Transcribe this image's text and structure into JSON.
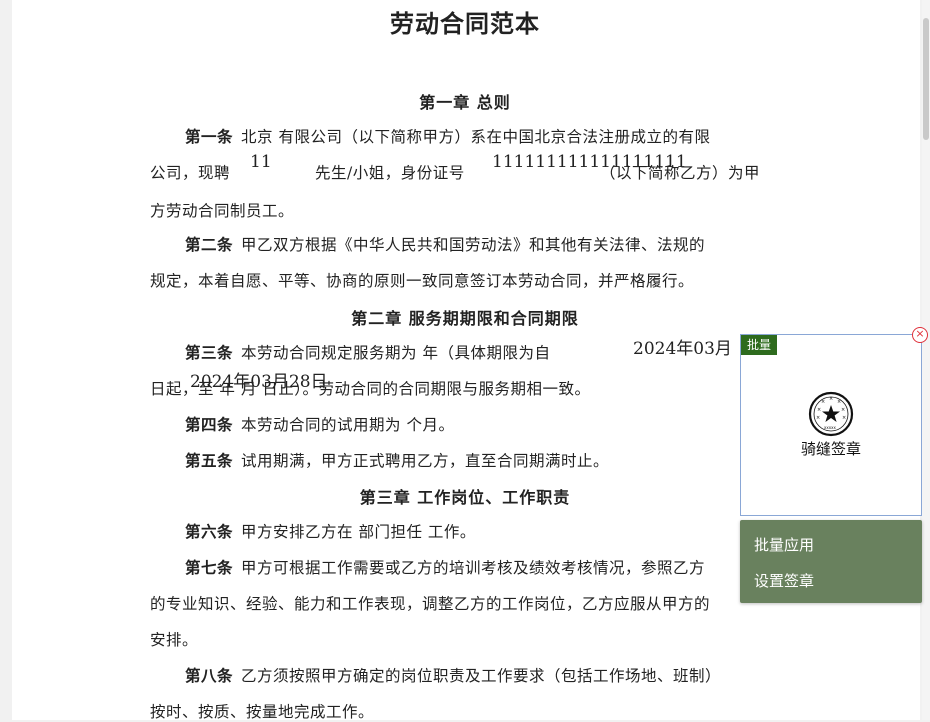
{
  "document": {
    "title": "劳动合同范本",
    "chapter1": "第一章  总则",
    "art1_label": "第一条",
    "art1_l1": "北京  有限公司（以下简称甲方）系在中国北京合法注册成立的有限",
    "art1_l2a": "公司，现聘",
    "art1_l2b": "先生/小姐，身份证号",
    "art1_l2c": "（以下简称乙方）为甲",
    "art1_l3": "方劳动合同制员工。",
    "art2_label": "第二条",
    "art2_l1": "甲乙双方根据《中华人民共和国劳动法》和其他有关法律、法规的",
    "art2_l2": "规定，本着自愿、平等、协商的原则一致同意签订本劳动合同，并严格履行。",
    "chapter2": "第二章  服务期期限和合同期限",
    "art3_label": "第三条",
    "art3_l1": "本劳动合同规定服务期为      年（具体期限为自",
    "art3_l2": "日起，至      年    月      日止）。劳动合同的合同期限与服务期相一致。",
    "art4_label": "第四条",
    "art4_l1": "本劳动合同的试用期为          个月。",
    "art5_label": "第五条",
    "art5_l1": "试用期满，甲方正式聘用乙方，直至合同期满时止。",
    "chapter3": "第三章  工作岗位、工作职责",
    "art6_label": "第六条",
    "art6_l1": "甲方安排乙方在  部门担任          工作。",
    "art7_label": "第七条",
    "art7_l1": "甲方可根据工作需要或乙方的培训考核及绩效考核情况，参照乙方",
    "art7_l2": "的专业知识、经验、能力和工作表现，调整乙方的工作岗位，乙方应服从甲方的",
    "art7_l3": "安排。",
    "art8_label": "第八条",
    "art8_l1": "乙方须按照甲方确定的岗位职责及工作要求（包括工作场地、班制）",
    "art8_l2": "按时、按质、按量地完成工作。"
  },
  "fields": {
    "employee_name": "11",
    "id_number": "111111111111111111",
    "start_date": "2024年03月",
    "end_date": "2024年03月28日"
  },
  "seal_panel": {
    "batch_tag": "批量",
    "close_glyph": "×",
    "stamp_label": "骑缝签章",
    "stamp_icon_text": "xxxxx"
  },
  "context_menu": {
    "items": [
      "批量应用",
      "设置签章"
    ]
  },
  "colors": {
    "batch_tag": "#2e6b1e",
    "menu_bg": "#69815e",
    "panel_border": "#8aa7d6",
    "close": "#e0303a"
  }
}
